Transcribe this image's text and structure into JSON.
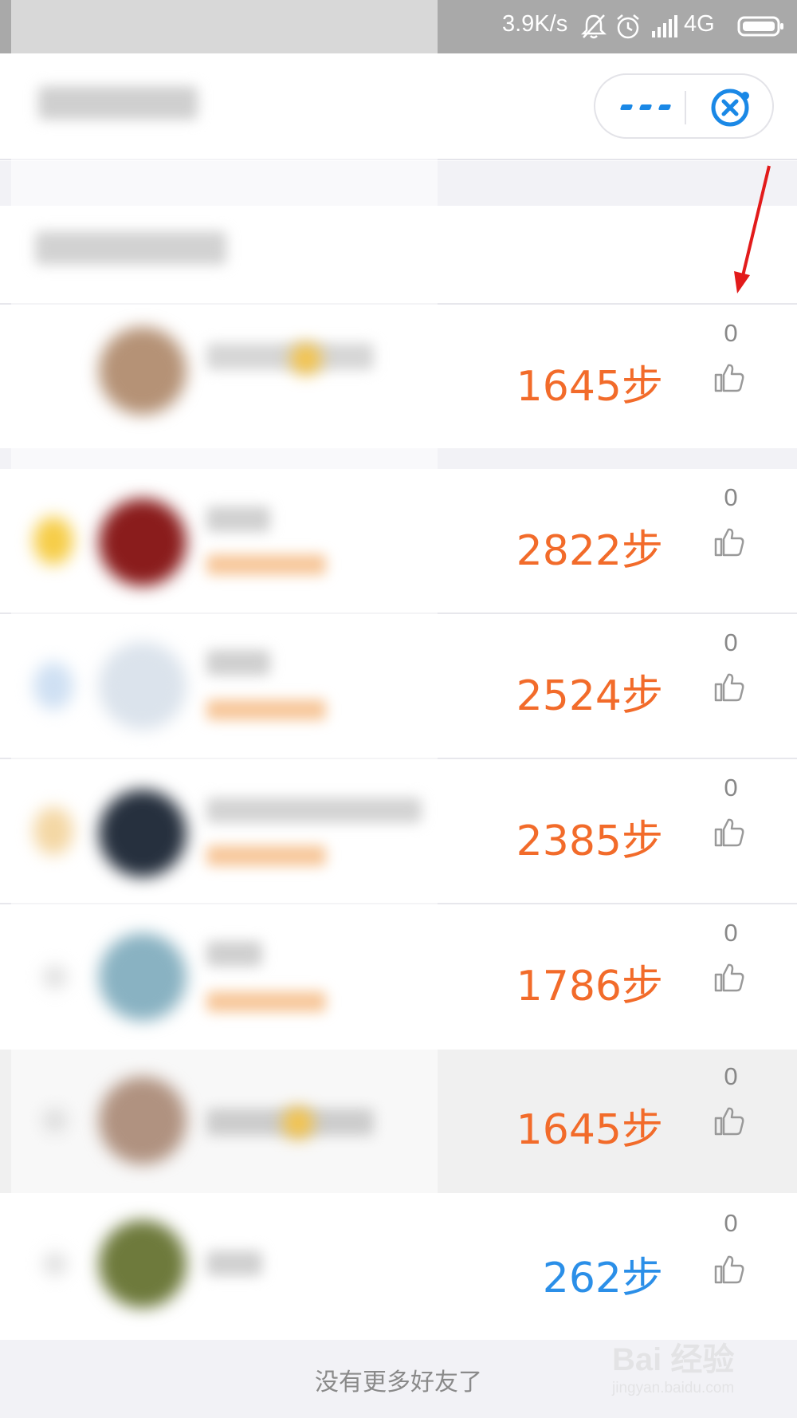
{
  "status_bar": {
    "speed": "3.9K/s",
    "network": "4G",
    "icons": [
      "bell-muted-icon",
      "alarm-icon",
      "signal-icon",
      "battery-icon"
    ]
  },
  "header": {
    "capsule": {
      "more_icon": "more-icon",
      "close_icon": "close-icon"
    }
  },
  "colors": {
    "steps_orange": "#f26b2a",
    "steps_blue": "#2b8fe8",
    "capsule_blue": "#1a88e6",
    "annotation_red": "#e21b1b"
  },
  "rows": [
    {
      "steps": "1645步",
      "likes": "0"
    },
    {
      "steps": "2822步",
      "likes": "0"
    },
    {
      "steps": "2524步",
      "likes": "0"
    },
    {
      "steps": "2385步",
      "likes": "0"
    },
    {
      "steps": "1786步",
      "likes": "0"
    },
    {
      "steps": "1645步",
      "likes": "0"
    },
    {
      "steps": "262步",
      "likes": "0"
    }
  ],
  "footer": {
    "text": "没有更多好友了"
  },
  "watermark": {
    "brand": "Bai 经验",
    "url": "jingyan.baidu.com"
  }
}
